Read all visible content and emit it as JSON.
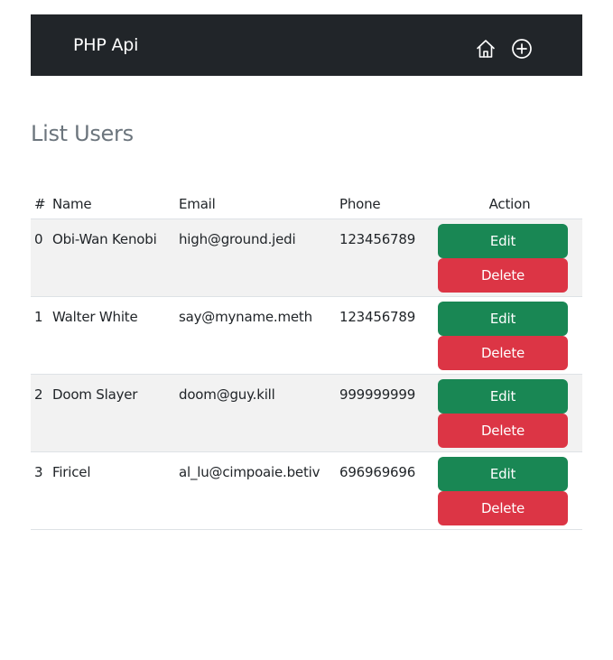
{
  "navbar": {
    "brand": "PHP Api",
    "home_icon": "house-icon",
    "add_icon": "plus-circle-icon"
  },
  "page": {
    "title": "List Users"
  },
  "table": {
    "headers": {
      "index": "#",
      "name": "Name",
      "email": "Email",
      "phone": "Phone",
      "action": "Action"
    },
    "rows": [
      {
        "index": "0",
        "name": "Obi-Wan Kenobi",
        "email": "high@ground.jedi",
        "phone": "123456789",
        "edit": "Edit",
        "delete": "Delete"
      },
      {
        "index": "1",
        "name": "Walter White",
        "email": "say@myname.meth",
        "phone": "123456789",
        "edit": "Edit",
        "delete": "Delete"
      },
      {
        "index": "2",
        "name": "Doom Slayer",
        "email": "doom@guy.kill",
        "phone": "999999999",
        "edit": "Edit",
        "delete": "Delete"
      },
      {
        "index": "3",
        "name": "Firicel",
        "email": "al_lu@cimpoaie.betiv",
        "phone": "696969696",
        "edit": "Edit",
        "delete": "Delete"
      }
    ]
  },
  "colors": {
    "navbar_bg": "#212529",
    "edit_button": "#198754",
    "delete_button": "#dc3545",
    "title_text": "#6c757d",
    "stripe": "#f2f2f2"
  }
}
